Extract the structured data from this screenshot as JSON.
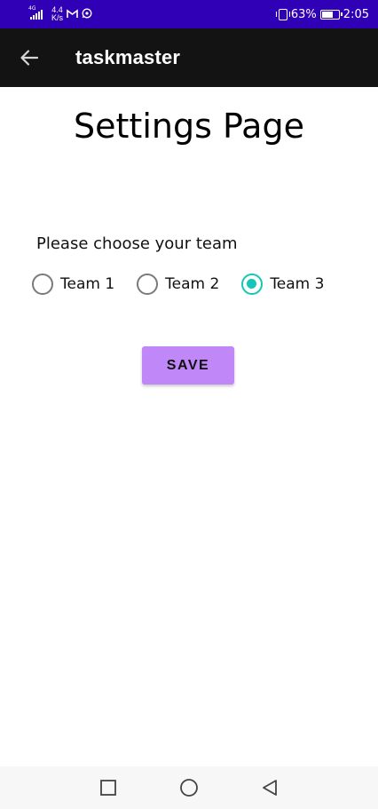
{
  "status_bar": {
    "network_type": "4G",
    "net_speed_value": "4.4",
    "net_speed_unit": "K/s",
    "battery_percent": "63%",
    "battery_level": 0.63,
    "time": "2:05",
    "icons": [
      "signal-icon",
      "gmail-icon",
      "whatsapp-icon",
      "vibrate-icon",
      "battery-charging-icon"
    ]
  },
  "app_bar": {
    "title": "taskmaster",
    "back_icon": "arrow-left-icon"
  },
  "page": {
    "title": "Settings Page",
    "team_prompt": "Please choose your team",
    "team_options": [
      {
        "label": "Team 1",
        "selected": false
      },
      {
        "label": "Team 2",
        "selected": false
      },
      {
        "label": "Team 3",
        "selected": true
      }
    ],
    "save_label": "SAVE"
  },
  "colors": {
    "status_bar": "#2f00b5",
    "app_bar": "#131313",
    "radio_selected": "#14c6b8",
    "save_button": "#bf87f8"
  },
  "nav_bar": {
    "buttons": [
      "recents-square-icon",
      "home-circle-icon",
      "back-triangle-icon"
    ]
  }
}
